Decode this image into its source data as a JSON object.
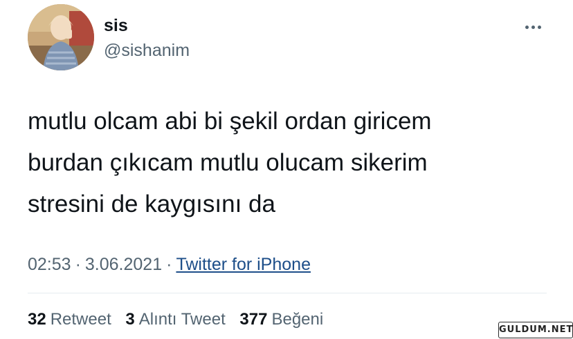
{
  "author": {
    "display_name": "sis",
    "handle": "@sishanim"
  },
  "tweet": {
    "text": "mutlu olcam abi bi şekil ordan giricem\nburdan çıkıcam mutlu olucam sikerim\nstresini de kaygısını da",
    "time": "02:53",
    "date": "3.06.2021",
    "separator": "·",
    "source": "Twitter for iPhone"
  },
  "stats": [
    {
      "count": "32",
      "label": "Retweet"
    },
    {
      "count": "3",
      "label": "Alıntı Tweet"
    },
    {
      "count": "377",
      "label": "Beğeni"
    }
  ],
  "watermark": "GULDUM.NET",
  "colors": {
    "text": "#0f1419",
    "secondary": "#536471",
    "link": "#1d4e89",
    "divider": "#e6ecf0"
  },
  "icons": {
    "more": "more-dots-icon"
  }
}
